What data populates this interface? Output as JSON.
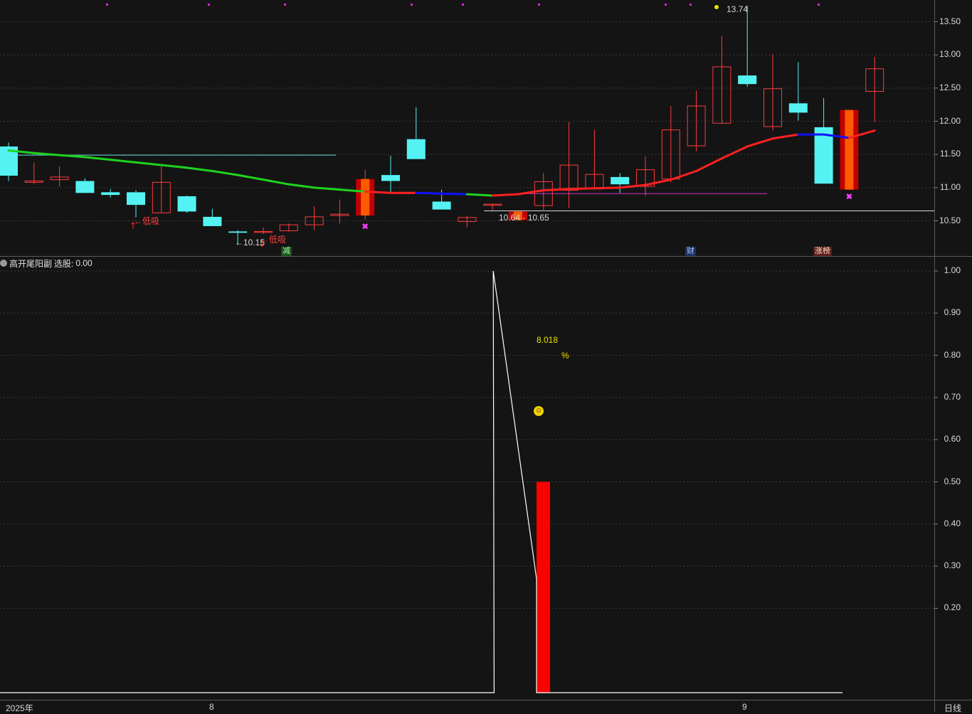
{
  "price_axis": {
    "ticks": [
      "13.50",
      "13.00",
      "12.50",
      "12.00",
      "11.50",
      "11.00",
      "10.50"
    ]
  },
  "indicator_axis": {
    "ticks": [
      "1.00",
      "0.90",
      "0.80",
      "0.70",
      "0.60",
      "0.50",
      "0.40",
      "0.30",
      "0.20"
    ]
  },
  "indicator": {
    "title": "高开尾阳副",
    "select_label": "选股:",
    "select_value": "0.00"
  },
  "annotations": {
    "high": "13.74",
    "low": "←10.15",
    "range": "10.64 - 10.65",
    "buy_signal_1": "←低吸",
    "buy_signal_2": "←低吸",
    "pct_value": "8.018",
    "pct_sign": "%"
  },
  "badges": {
    "reduce": "减",
    "finance": "财",
    "limit_list": "涨榜"
  },
  "date_axis": {
    "year": "2025年",
    "month_8": "8",
    "month_9": "9",
    "period": "日线"
  },
  "colors": {
    "up": "#ff3b3b",
    "down": "#54f2f2",
    "ma_green": "#1ed31e",
    "ma_red": "#ff2020",
    "ma_blue": "#1010ff"
  },
  "chart_data": [
    {
      "type": "candlestick",
      "ylim": [
        10.0,
        13.8
      ],
      "candles": [
        {
          "o": 11.62,
          "h": 11.68,
          "l": 11.1,
          "c": 11.18
        },
        {
          "o": 11.08,
          "h": 11.38,
          "l": 11.05,
          "c": 11.1
        },
        {
          "o": 11.12,
          "h": 11.32,
          "l": 11.02,
          "c": 11.16
        },
        {
          "o": 11.1,
          "h": 11.14,
          "l": 10.92,
          "c": 10.92
        },
        {
          "o": 10.93,
          "h": 10.98,
          "l": 10.85,
          "c": 10.89
        },
        {
          "o": 10.93,
          "h": 10.96,
          "l": 10.55,
          "c": 10.74
        },
        {
          "o": 10.62,
          "h": 11.32,
          "l": 10.62,
          "c": 11.08
        },
        {
          "o": 10.87,
          "h": 10.88,
          "l": 10.62,
          "c": 10.64
        },
        {
          "o": 10.56,
          "h": 10.68,
          "l": 10.42,
          "c": 10.42
        },
        {
          "o": 10.34,
          "h": 10.36,
          "l": 10.15,
          "c": 10.32
        },
        {
          "o": 10.33,
          "h": 10.4,
          "l": 10.3,
          "c": 10.34
        },
        {
          "o": 10.35,
          "h": 10.46,
          "l": 10.34,
          "c": 10.44
        },
        {
          "o": 10.44,
          "h": 10.72,
          "l": 10.36,
          "c": 10.56
        },
        {
          "o": 10.58,
          "h": 10.82,
          "l": 10.46,
          "c": 10.6
        },
        {
          "o": 10.58,
          "h": 11.27,
          "l": 10.52,
          "c": 11.13
        },
        {
          "o": 11.19,
          "h": 11.48,
          "l": 10.93,
          "c": 11.1
        },
        {
          "o": 11.73,
          "h": 12.21,
          "l": 11.43,
          "c": 11.43
        },
        {
          "o": 10.79,
          "h": 10.97,
          "l": 10.68,
          "c": 10.67
        },
        {
          "o": 10.49,
          "h": 10.57,
          "l": 10.4,
          "c": 10.55
        },
        {
          "o": 10.75,
          "h": 10.76,
          "l": 10.66,
          "c": 10.75
        },
        {
          "o": 10.51,
          "h": 10.65,
          "l": 10.51,
          "c": 10.64
        },
        {
          "o": 10.73,
          "h": 11.22,
          "l": 10.65,
          "c": 11.09
        },
        {
          "o": 10.96,
          "h": 11.99,
          "l": 10.69,
          "c": 11.34
        },
        {
          "o": 10.98,
          "h": 11.87,
          "l": 10.98,
          "c": 11.2
        },
        {
          "o": 11.16,
          "h": 11.22,
          "l": 10.92,
          "c": 11.05
        },
        {
          "o": 11.02,
          "h": 11.47,
          "l": 10.87,
          "c": 11.27
        },
        {
          "o": 11.13,
          "h": 12.23,
          "l": 11.08,
          "c": 11.87
        },
        {
          "o": 11.63,
          "h": 12.46,
          "l": 11.55,
          "c": 12.23
        },
        {
          "o": 11.97,
          "h": 13.28,
          "l": 11.97,
          "c": 12.82
        },
        {
          "o": 12.69,
          "h": 13.74,
          "l": 12.52,
          "c": 12.56
        },
        {
          "o": 11.92,
          "h": 13.01,
          "l": 11.86,
          "c": 12.49
        },
        {
          "o": 12.27,
          "h": 12.89,
          "l": 12.01,
          "c": 12.13
        },
        {
          "o": 11.91,
          "h": 12.35,
          "l": 11.06,
          "c": 11.06
        },
        {
          "o": 10.97,
          "h": 12.17,
          "l": 10.97,
          "c": 12.17
        },
        {
          "o": 12.45,
          "h": 12.97,
          "l": 11.99,
          "c": 12.79
        }
      ],
      "moving_average": [
        11.56,
        11.52,
        11.49,
        11.46,
        11.42,
        11.38,
        11.34,
        11.3,
        11.25,
        11.19,
        11.12,
        11.05,
        11.0,
        10.97,
        10.94,
        10.92,
        10.92,
        10.91,
        10.9,
        10.88,
        10.9,
        10.96,
        10.98,
        10.99,
        11.0,
        11.04,
        11.12,
        11.25,
        11.44,
        11.62,
        11.74,
        11.8,
        11.8,
        11.75,
        11.86
      ],
      "reference_lines": [
        11.49,
        10.91
      ]
    },
    {
      "type": "line",
      "ylim": [
        0,
        1.0
      ],
      "values": [
        0,
        0,
        0,
        0,
        0,
        0,
        0,
        0,
        0,
        0,
        0,
        0,
        0,
        0,
        0,
        0,
        0,
        0,
        0,
        1,
        0.27,
        0,
        0,
        0,
        0,
        0,
        0,
        0,
        0,
        0,
        0,
        0,
        0,
        0,
        0
      ],
      "bar": {
        "index": 20,
        "value": 0.5
      }
    }
  ]
}
